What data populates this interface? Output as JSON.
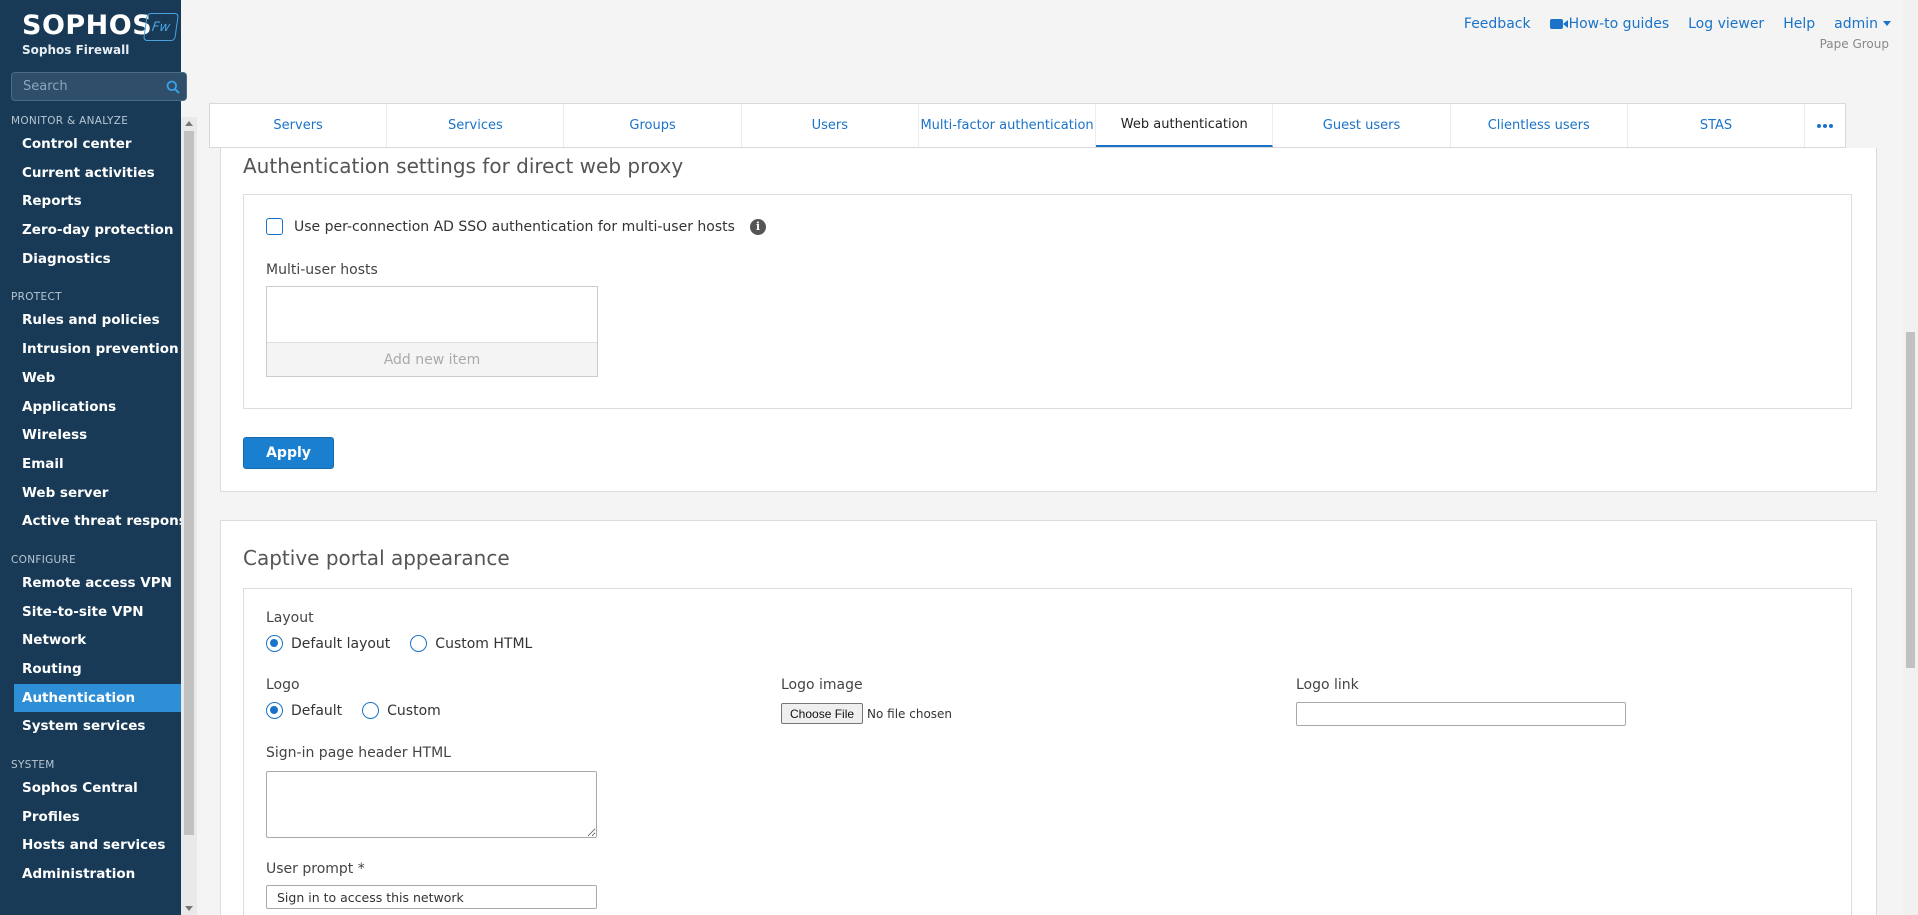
{
  "brand": {
    "name": "SOPHOS",
    "product": "Sophos Firewall",
    "badge": "Fw"
  },
  "search": {
    "placeholder": "Search"
  },
  "nav": {
    "monitor": {
      "title": "MONITOR & ANALYZE",
      "items": [
        "Control center",
        "Current activities",
        "Reports",
        "Zero-day protection",
        "Diagnostics"
      ]
    },
    "protect": {
      "title": "PROTECT",
      "items": [
        "Rules and policies",
        "Intrusion prevention",
        "Web",
        "Applications",
        "Wireless",
        "Email",
        "Web server",
        "Active threat response"
      ]
    },
    "configure": {
      "title": "CONFIGURE",
      "items": [
        "Remote access VPN",
        "Site-to-site VPN",
        "Network",
        "Routing",
        "Authentication",
        "System services"
      ]
    },
    "system": {
      "title": "SYSTEM",
      "items": [
        "Sophos Central",
        "Profiles",
        "Hosts and services",
        "Administration"
      ]
    }
  },
  "toplinks": {
    "feedback": "Feedback",
    "guides": "How-to guides",
    "log_viewer": "Log viewer",
    "help": "Help",
    "user": "admin",
    "org": "Pape Group"
  },
  "tabs": [
    "Servers",
    "Services",
    "Groups",
    "Users",
    "Multi-factor authentication",
    "Web authentication",
    "Guest users",
    "Clientless users",
    "STAS"
  ],
  "proxy_section": {
    "title": "Authentication settings for direct web proxy",
    "sso_checkbox_label": "Use per-connection AD SSO authentication for multi-user hosts",
    "multi_user_hosts_label": "Multi-user hosts",
    "add_new_item": "Add new item",
    "apply": "Apply"
  },
  "portal_section": {
    "title": "Captive portal appearance",
    "layout_label": "Layout",
    "layout_default": "Default layout",
    "layout_custom": "Custom HTML",
    "logo_label": "Logo",
    "logo_default": "Default",
    "logo_custom": "Custom",
    "logo_image_label": "Logo image",
    "choose_file": "Choose File",
    "no_file": "No file chosen",
    "logo_link_label": "Logo link",
    "logo_link_value": "",
    "header_html_label": "Sign-in page header HTML",
    "user_prompt_label": "User prompt *",
    "user_prompt_value": "Sign in to access this network"
  },
  "colors": {
    "sidebar": "#183a56",
    "accent": "#1a73c8",
    "active_nav": "#2f8fd6",
    "apply_button": "#1b7fd0"
  }
}
